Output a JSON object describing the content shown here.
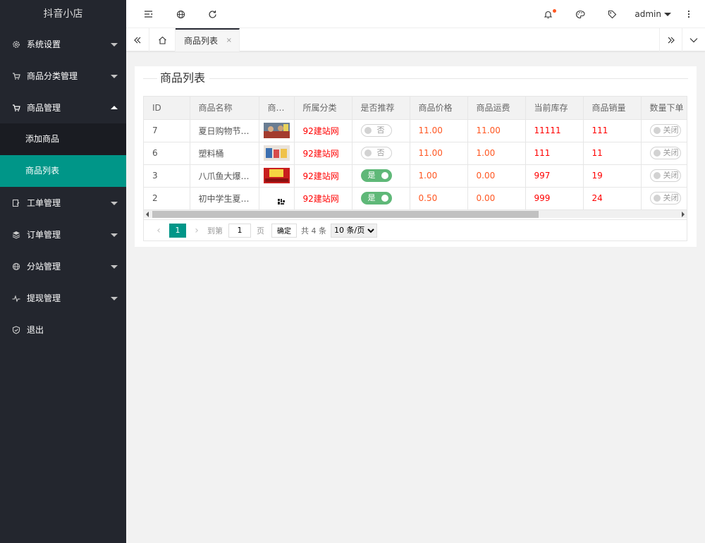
{
  "sidebar": {
    "title": "抖音小店",
    "menu": [
      {
        "label": "系统设置",
        "icon": "gear-icon"
      },
      {
        "label": "商品分类管理",
        "icon": "cart-icon"
      },
      {
        "label": "商品管理",
        "icon": "cart-icon",
        "expanded": true
      },
      {
        "label": "工单管理",
        "icon": "edit-doc-icon"
      },
      {
        "label": "订单管理",
        "icon": "layers-icon"
      },
      {
        "label": "分站管理",
        "icon": "globe-icon"
      },
      {
        "label": "提现管理",
        "icon": "pulse-icon"
      },
      {
        "label": "退出",
        "icon": "shield-icon"
      }
    ],
    "submenu": [
      {
        "label": "添加商品"
      },
      {
        "label": "商品列表",
        "active": true
      }
    ]
  },
  "header": {
    "user": "admin",
    "icons": [
      "menu-fold-icon",
      "globe-icon",
      "refresh-icon",
      "bell-icon",
      "palette-icon",
      "tag-icon",
      "more-vertical-icon"
    ]
  },
  "tabs": {
    "current": "商品列表",
    "close": "×"
  },
  "page": {
    "legend": "商品列表"
  },
  "table": {
    "headers": [
      "ID",
      "商品名称",
      "商…",
      "所属分类",
      "是否推荐",
      "商品价格",
      "商品运费",
      "当前库存",
      "商品销量",
      "数量下单"
    ],
    "rows": [
      {
        "id": "7",
        "name": "夏日购物节…",
        "category": "92建站网",
        "recommend": "否",
        "recommend_on": false,
        "price": "11.00",
        "freight": "11.00",
        "stock": "11111",
        "sales": "111",
        "qty_switch": "关闭"
      },
      {
        "id": "6",
        "name": "塑料桶",
        "category": "92建站网",
        "recommend": "否",
        "recommend_on": false,
        "price": "11.00",
        "freight": "1.00",
        "stock": "111",
        "sales": "11",
        "qty_switch": "关闭"
      },
      {
        "id": "3",
        "name": "八爪鱼大爆…",
        "category": "92建站网",
        "recommend": "是",
        "recommend_on": true,
        "price": "1.00",
        "freight": "0.00",
        "stock": "997",
        "sales": "19",
        "qty_switch": "关闭"
      },
      {
        "id": "2",
        "name": "初中学生夏…",
        "category": "92建站网",
        "recommend": "是",
        "recommend_on": true,
        "price": "0.50",
        "freight": "0.00",
        "stock": "999",
        "sales": "24",
        "qty_switch": "关闭"
      }
    ]
  },
  "pager": {
    "current": "1",
    "goto_label": "到第",
    "page_input": "1",
    "page_unit": "页",
    "ok": "确定",
    "total": "共 4 条",
    "per_page": "10 条/页"
  },
  "colors": {
    "accent": "#009688",
    "sidebar_bg": "#23262e",
    "switch_on": "#5fb878",
    "price": "#ff5722",
    "red": "#ff0000"
  }
}
